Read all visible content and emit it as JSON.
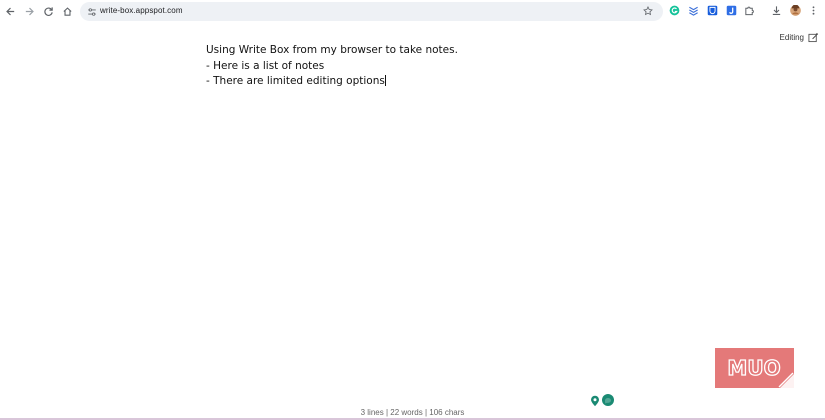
{
  "browser": {
    "url": "write-box.appspot.com",
    "icons": {
      "back": "back-arrow-icon",
      "forward": "forward-arrow-icon",
      "reload": "reload-icon",
      "home": "home-icon",
      "site_info": "tune-icon",
      "bookmark": "star-icon"
    },
    "extensions": [
      "grammarly-icon",
      "layers-icon",
      "bitwarden-icon",
      "j-icon",
      "puzzle-icon",
      "download-icon",
      "profile-avatar",
      "more-icon"
    ]
  },
  "page": {
    "status_label": "Editing",
    "lines": [
      "Using Write Box from my browser to take notes.",
      "- Here is a list of notes",
      "- There are limited editing options"
    ],
    "stats": "3 lines | 22 words | 106 chars"
  },
  "watermark": {
    "text": "MUO"
  },
  "colors": {
    "omnibox_bg": "#eef1f5",
    "logo_bg": "#e06666",
    "accent_green": "#1a8a73",
    "text": "#111111"
  }
}
